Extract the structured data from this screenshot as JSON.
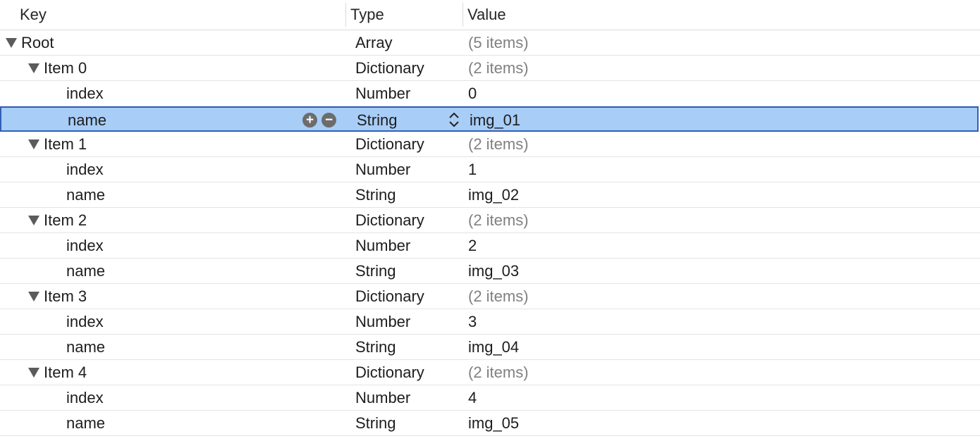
{
  "columns": {
    "key": "Key",
    "type": "Type",
    "value": "Value"
  },
  "rows": [
    {
      "key": "Root",
      "type": "Array",
      "value": "(5 items)",
      "level": 0,
      "expandable": true,
      "muted": true
    },
    {
      "key": "Item 0",
      "type": "Dictionary",
      "value": "(2 items)",
      "level": 1,
      "expandable": true,
      "muted": true
    },
    {
      "key": "index",
      "type": "Number",
      "value": "0",
      "level": 2,
      "expandable": false,
      "muted": false
    },
    {
      "key": "name",
      "type": "String",
      "value": "img_01",
      "level": 2,
      "expandable": false,
      "muted": false,
      "selected": true
    },
    {
      "key": "Item 1",
      "type": "Dictionary",
      "value": "(2 items)",
      "level": 1,
      "expandable": true,
      "muted": true
    },
    {
      "key": "index",
      "type": "Number",
      "value": "1",
      "level": 2,
      "expandable": false,
      "muted": false
    },
    {
      "key": "name",
      "type": "String",
      "value": "img_02",
      "level": 2,
      "expandable": false,
      "muted": false
    },
    {
      "key": "Item 2",
      "type": "Dictionary",
      "value": "(2 items)",
      "level": 1,
      "expandable": true,
      "muted": true
    },
    {
      "key": "index",
      "type": "Number",
      "value": "2",
      "level": 2,
      "expandable": false,
      "muted": false
    },
    {
      "key": "name",
      "type": "String",
      "value": "img_03",
      "level": 2,
      "expandable": false,
      "muted": false
    },
    {
      "key": "Item 3",
      "type": "Dictionary",
      "value": "(2 items)",
      "level": 1,
      "expandable": true,
      "muted": true
    },
    {
      "key": "index",
      "type": "Number",
      "value": "3",
      "level": 2,
      "expandable": false,
      "muted": false
    },
    {
      "key": "name",
      "type": "String",
      "value": "img_04",
      "level": 2,
      "expandable": false,
      "muted": false
    },
    {
      "key": "Item 4",
      "type": "Dictionary",
      "value": "(2 items)",
      "level": 1,
      "expandable": true,
      "muted": true
    },
    {
      "key": "index",
      "type": "Number",
      "value": "4",
      "level": 2,
      "expandable": false,
      "muted": false
    },
    {
      "key": "name",
      "type": "String",
      "value": "img_05",
      "level": 2,
      "expandable": false,
      "muted": false
    }
  ],
  "selected_row_controls": {
    "add_symbol": "+",
    "remove_symbol": "−"
  },
  "icons": {
    "disclosure": "disclosure-triangle-icon",
    "add": "plus-circle-icon",
    "remove": "minus-circle-icon",
    "stepper": "up-down-chevron-icon"
  },
  "colors": {
    "selection_bg": "#a8cdf7",
    "selection_border": "#2f5fb7",
    "muted_text": "#808080"
  }
}
